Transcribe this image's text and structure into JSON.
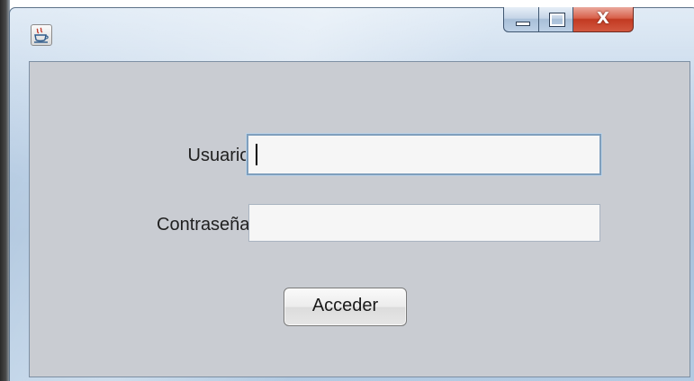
{
  "window": {
    "icon": "java-coffee-cup-icon",
    "controls": {
      "minimize_icon": "minimize-icon",
      "maximize_icon": "maximize-icon",
      "close_icon": "close-icon",
      "close_glyph": "X"
    }
  },
  "form": {
    "user_label": "Usuario:",
    "user_value": "",
    "password_label": "Contraseña:",
    "password_value": "",
    "submit_label": "Acceder"
  },
  "colors": {
    "client_background": "#c9ccd2",
    "close_button": "#c23a22",
    "focus_border": "#7f9fbd"
  }
}
